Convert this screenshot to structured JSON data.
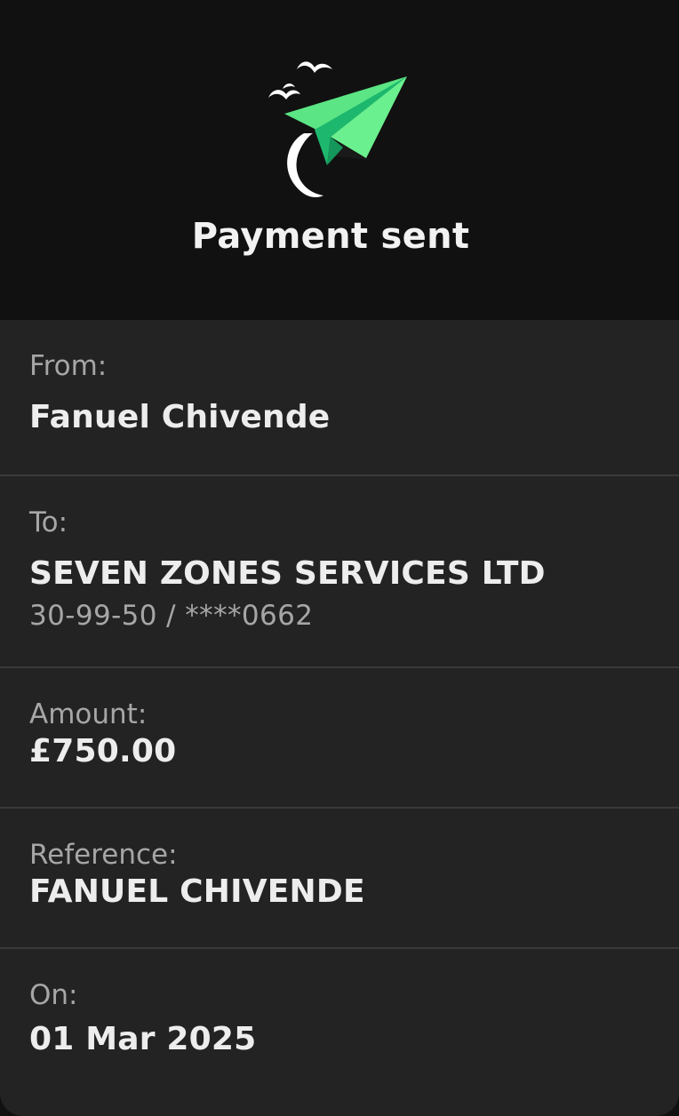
{
  "header": {
    "icon": "paper-plane-sent-icon",
    "title": "Payment sent"
  },
  "colors": {
    "background": "#111111",
    "card": "#232323",
    "accent_green": "#5BE584",
    "accent_green_dark": "#1DB86E"
  },
  "details": {
    "from": {
      "label": "From:",
      "value": "Fanuel Chivende"
    },
    "to": {
      "label": "To:",
      "value": "SEVEN ZONES SERVICES LTD",
      "account": "30-99-50 / ****0662"
    },
    "amount": {
      "label": "Amount:",
      "value": "£750.00"
    },
    "reference": {
      "label": "Reference:",
      "value": "FANUEL CHIVENDE"
    },
    "on": {
      "label": "On:",
      "value": "01 Mar 2025"
    }
  }
}
